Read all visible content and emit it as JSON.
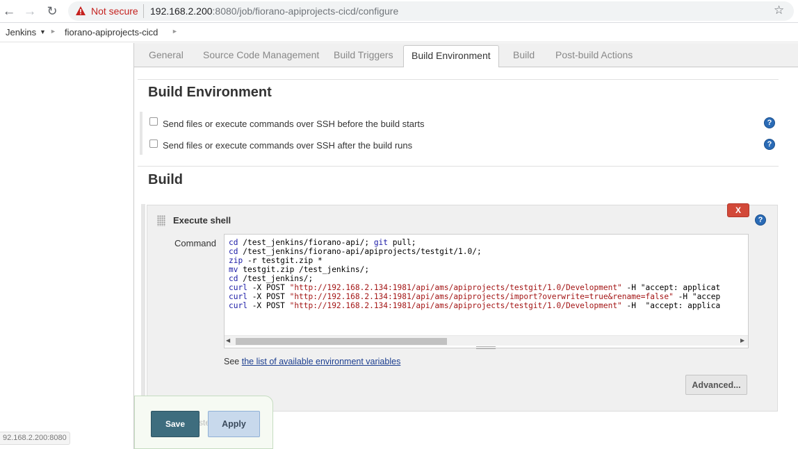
{
  "browser": {
    "not_secure": "Not secure",
    "url_host": "192.168.2.200",
    "url_rest": ":8080/job/fiorano-apiprojects-cicd/configure"
  },
  "breadcrumb": {
    "root": "Jenkins",
    "job": "fiorano-apiprojects-cicd"
  },
  "tabs": [
    {
      "label": "General"
    },
    {
      "label": "Source Code Management"
    },
    {
      "label": "Build Triggers"
    },
    {
      "label": "Build Environment",
      "active": true
    },
    {
      "label": "Build"
    },
    {
      "label": "Post-build Actions"
    }
  ],
  "build_environment": {
    "title": "Build Environment",
    "options": [
      {
        "label": "Send files or execute commands over SSH before the build starts",
        "checked": false
      },
      {
        "label": "Send files or execute commands over SSH after the build runs",
        "checked": false
      }
    ]
  },
  "build": {
    "title": "Build",
    "step": {
      "title": "Execute shell",
      "delete_label": "X",
      "command_label": "Command",
      "command_lines": [
        "cd /test_jenkins/fiorano-api/; git pull;",
        "cd /test_jenkins/fiorano-api/apiprojects/testgit/1.0/;",
        "zip -r testgit.zip *",
        "mv testgit.zip /test_jenkins/;",
        "cd /test_jenkins/;",
        "curl -X POST \"http://192.168.2.134:1981/api/ams/apiprojects/testgit/1.0/Development\" -H \"accept: applicat",
        "curl -X POST \"http://192.168.2.134:1981/api/ams/apiprojects/import?overwrite=true&rename=false\" -H \"accep",
        "curl -X POST \"http://192.168.2.134:1981/api/ams/apiprojects/testgit/1.0/Development\" -H  \"accept: applica"
      ],
      "see_prefix": "See ",
      "env_link": "the list of available environment variables",
      "advanced_label": "Advanced..."
    }
  },
  "footer": {
    "save_label": "Save",
    "apply_label": "Apply",
    "ghost_text": "ste"
  },
  "status_url": "92.168.2.200:8080",
  "colors": {
    "save_bg": "#3e6d7e",
    "apply_bg": "#c8d9ec",
    "delete_bg": "#d24939",
    "help_bg": "#2a6bb6",
    "not_secure": "#c5221f"
  }
}
